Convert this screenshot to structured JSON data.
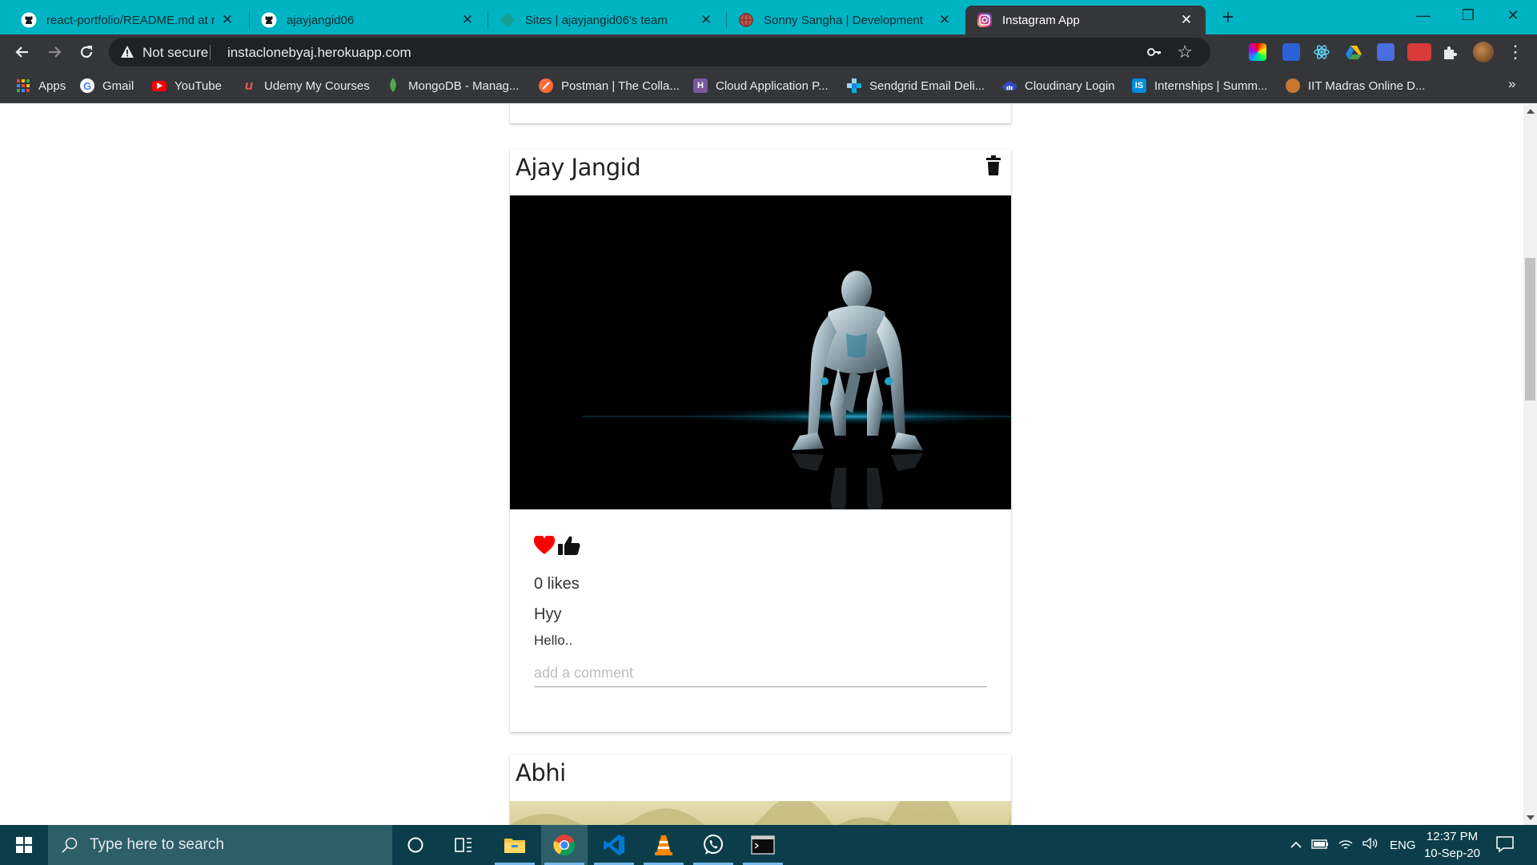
{
  "browser": {
    "tabs": [
      {
        "title": "react-portfolio/README.md at m",
        "favicon": "github-icon",
        "active": false
      },
      {
        "title": "ajayjangid06",
        "favicon": "github-icon",
        "active": false
      },
      {
        "title": "Sites | ajayjangid06's team",
        "favicon": "netlify-icon",
        "active": false
      },
      {
        "title": "Sonny Sangha | Development",
        "favicon": "globe-icon",
        "active": false
      },
      {
        "title": "Instagram App",
        "favicon": "instagram-icon",
        "active": true
      }
    ],
    "new_tab_label": "+",
    "window_controls": {
      "minimize": "—",
      "restore": "❐",
      "close": "✕"
    },
    "address_bar": {
      "security_label": "Not secure",
      "url": "instaclonebyaj.herokuapp.com"
    },
    "bookmarks": [
      {
        "label": "Apps",
        "icon": "apps-grid-icon"
      },
      {
        "label": "Gmail",
        "icon": "google-icon"
      },
      {
        "label": "YouTube",
        "icon": "youtube-icon"
      },
      {
        "label": "Udemy My Courses",
        "icon": "udemy-icon"
      },
      {
        "label": "MongoDB - Manag...",
        "icon": "mongodb-icon"
      },
      {
        "label": "Postman | The Colla...",
        "icon": "postman-icon"
      },
      {
        "label": "Cloud Application P...",
        "icon": "heroku-icon"
      },
      {
        "label": "Sendgrid Email Deli...",
        "icon": "sendgrid-icon"
      },
      {
        "label": "Cloudinary Login",
        "icon": "cloudinary-icon"
      },
      {
        "label": "Internships | Summ...",
        "icon": "internshala-icon"
      },
      {
        "label": "IIT Madras Online D...",
        "icon": "iit-madras-icon"
      }
    ],
    "bookmarks_overflow": "»",
    "colors": {
      "tab_strip": "#00b3c2",
      "toolbar": "#35363a"
    }
  },
  "posts": [
    {
      "author": "Ajay Jangid",
      "image": "robot-crouching-on-dark-background",
      "likes_text": "0 likes",
      "caption_title": "Hyy",
      "caption_body": "Hello..",
      "comment_placeholder": "add a comment",
      "like_icon_color": "#ff0000"
    },
    {
      "author": "Abhi",
      "image": "outdoor-greenery-photo"
    }
  ],
  "taskbar": {
    "search_placeholder": "Type here to search",
    "pinned_apps": [
      "cortana-icon",
      "task-view-icon",
      "file-explorer-icon",
      "chrome-icon",
      "vscode-icon",
      "vlc-icon",
      "whatsapp-icon",
      "terminal-icon"
    ],
    "tray_language": "ENG",
    "time": "12:37 PM",
    "date": "10-Sep-20"
  }
}
